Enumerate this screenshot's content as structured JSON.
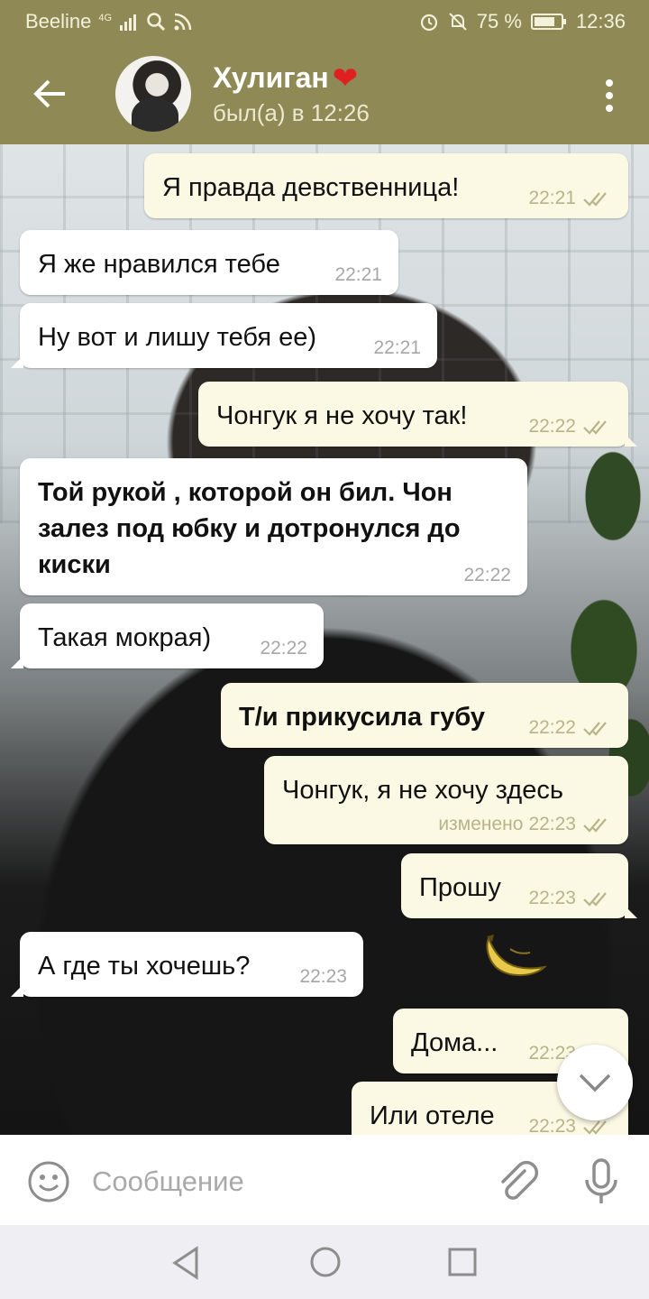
{
  "status_bar": {
    "carrier": "Beeline",
    "network": "4G",
    "battery_percent": "75 %",
    "time": "12:36"
  },
  "header": {
    "name": "Хулиган",
    "name_emoji": "❤",
    "last_seen": "был(а) в 12:26"
  },
  "messages": [
    {
      "text": "Я правда девственница!",
      "time": "22:21",
      "dir": "out",
      "read": true
    },
    {
      "text": "Я же нравился тебе",
      "time": "22:21",
      "dir": "in"
    },
    {
      "text": "Ну вот и лишу тебя ее)",
      "time": "22:21",
      "dir": "in"
    },
    {
      "text": "Чонгук я не хочу так!",
      "time": "22:22",
      "dir": "out",
      "read": true
    },
    {
      "text": "Той рукой , которой он бил. Чон залез под юбку и дотронулся до киски",
      "time": "22:22",
      "dir": "in",
      "bold": true
    },
    {
      "text": "Такая мокрая)",
      "time": "22:22",
      "dir": "in"
    },
    {
      "text": "Т/и прикусила губу",
      "time": "22:22",
      "dir": "out",
      "bold": true,
      "read": true
    },
    {
      "text": "Чонгук, я не хочу здесь",
      "time": "22:23",
      "edited_label": "изменено",
      "dir": "out",
      "read": true
    },
    {
      "text": "Прошу",
      "time": "22:23",
      "dir": "out",
      "read": true
    },
    {
      "text": "А где ты хочешь?",
      "time": "22:23",
      "dir": "in"
    },
    {
      "text": "Дома...",
      "time": "22:23",
      "dir": "out",
      "read": true
    },
    {
      "text": "Или отеле",
      "time": "22:23",
      "dir": "out",
      "read": true
    }
  ],
  "sticker": {
    "icon": "banana-sticker"
  },
  "input": {
    "placeholder": "Сообщение"
  },
  "colors": {
    "header": "#8f8a55",
    "outgoing_bubble": "#fbf8e3",
    "incoming_bubble": "#ffffff",
    "check": "#b8b48a"
  }
}
